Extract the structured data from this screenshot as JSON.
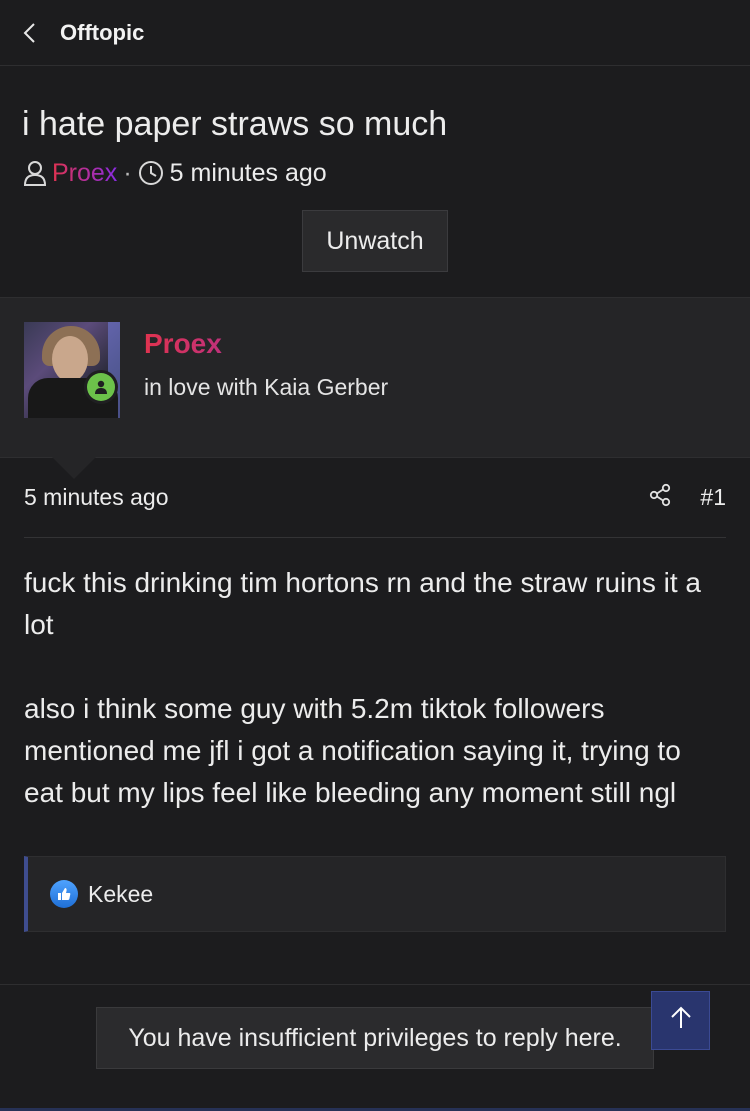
{
  "top_bar": {
    "title": "Offtopic",
    "back_icon": "chevron-left-icon"
  },
  "thread": {
    "title": "i hate paper straws so much",
    "author": "Proex",
    "separator": "·",
    "time": "5 minutes ago",
    "unwatch_label": "Unwatch"
  },
  "user": {
    "name": "Proex",
    "user_title": "in love with Kaia Gerber",
    "status_color": "#6cc24a"
  },
  "post": {
    "time": "5 minutes ago",
    "number": "#1",
    "paragraphs": [
      "fuck this drinking tim hortons rn and the straw ruins it a lot",
      "also i think some guy with 5.2m tiktok followers mentioned me jfl i got a notification saying it, trying to eat but my lips feel like bleeding any moment still ngl"
    ]
  },
  "reactions": {
    "users": "Kekee",
    "icon": "thumbs-up-icon"
  },
  "notice": "You have insufficient privileges to reply here.",
  "colors": {
    "accent_start": "#e0334f",
    "accent_end": "#8a2be2",
    "scroll_button": "#29356e"
  }
}
